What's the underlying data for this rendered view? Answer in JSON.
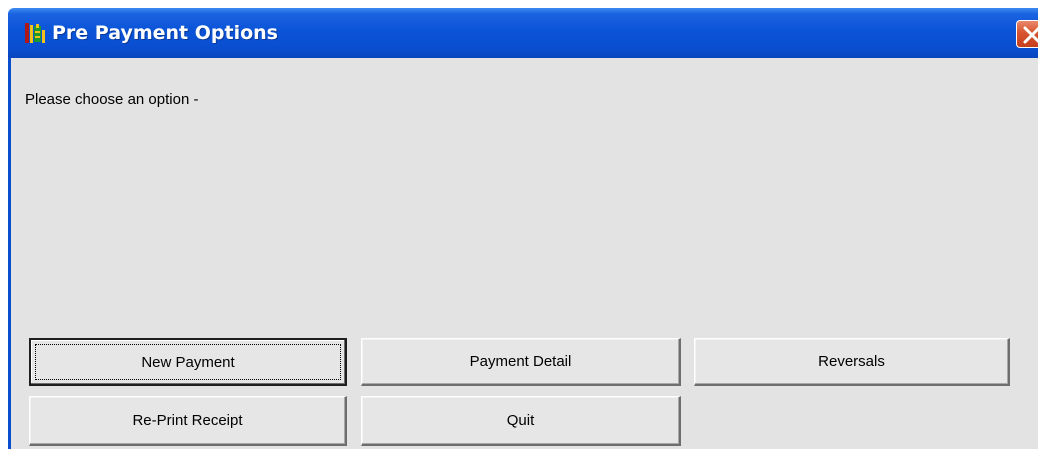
{
  "window": {
    "title": "Pre Payment Options",
    "app_icon": "app-logo-icon",
    "close_icon": "close-icon",
    "colors": {
      "titlebar": "#0a54d8",
      "close_button": "#d8542f",
      "client_background": "#e3e3e3"
    }
  },
  "content": {
    "prompt": "Please choose an option -"
  },
  "buttons": {
    "new_payment": "New Payment",
    "payment_detail": "Payment Detail",
    "reversals": "Reversals",
    "reprint_receipt": "Re-Print Receipt",
    "quit": "Quit"
  }
}
